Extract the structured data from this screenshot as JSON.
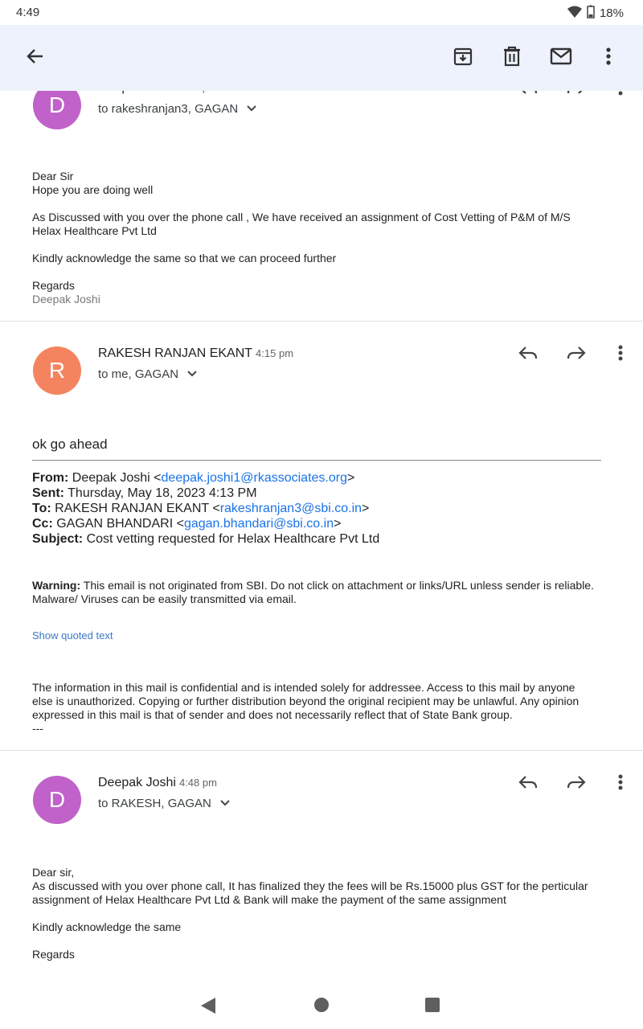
{
  "status": {
    "time": "4:49",
    "battery": "18%"
  },
  "toolbar": {
    "back_icon": "arrow-back-icon",
    "archive_icon": "archive-icon",
    "delete_icon": "trash-icon",
    "mark_unread_icon": "mail-icon",
    "more_icon": "more-vert-icon"
  },
  "messages": [
    {
      "avatar_letter": "D",
      "avatar_color": "#c062c9",
      "sender": "Deepak Joshi",
      "time": "4:13 pm",
      "recipients": "to rakeshranjan3, GAGAN",
      "body": [
        "Dear Sir",
        "Hope you are doing well",
        "As Discussed with you over the phone call , We have received an assignment of Cost Vetting of P&M of M/S",
        "Helax Healthcare Pvt Ltd",
        "Kindly acknowledge the same so that we can proceed further",
        "Regards",
        "Deepak Joshi"
      ]
    },
    {
      "avatar_letter": "R",
      "avatar_color": "#f4845f",
      "sender": "RAKESH RANJAN EKANT",
      "time": "4:15 pm",
      "recipients": "to me, GAGAN",
      "reply": "ok go ahead",
      "quoted": {
        "from_label": "From:",
        "from_name": "Deepak Joshi <",
        "from_email": "deepak.joshi1@rkassociates.org",
        "from_end": ">",
        "sent_label": "Sent:",
        "sent": "Thursday, May 18, 2023 4:13 PM",
        "to_label": "To:",
        "to_name": "RAKESH RANJAN EKANT <",
        "to_email": "rakeshranjan3@sbi.co.in",
        "to_end": ">",
        "cc_label": "Cc:",
        "cc_name": "GAGAN BHANDARI <",
        "cc_email": "gagan.bhandari@sbi.co.in",
        "cc_end": ">",
        "subject_label": "Subject:",
        "subject": "Cost vetting requested for Helax Healthcare Pvt Ltd"
      },
      "warning_label": "Warning:",
      "warning": "This email is not originated from SBI. Do not click on attachment or links/URL unless sender is reliable.",
      "warning2": "Malware/ Viruses can be easily transmitted via email.",
      "show_quoted": "Show quoted text",
      "disclaimer": [
        "The information in this mail is confidential and is intended solely for addressee. Access to this mail by anyone",
        "else is unauthorized. Copying or further distribution beyond the original recipient may be unlawful. Any opinion",
        "expressed in this mail is that of sender and does not necessarily reflect that of State Bank group.",
        "---"
      ]
    },
    {
      "avatar_letter": "D",
      "avatar_color": "#c062c9",
      "sender": "Deepak Joshi",
      "time": "4:48 pm",
      "recipients": "to RAKESH, GAGAN",
      "body": [
        "Dear sir,",
        "As discussed with you over phone call, It has finalized they the fees will be Rs.15000 plus GST for the perticular",
        "assignment of Helax Healthcare Pvt Ltd & Bank will make the payment of the same assignment",
        "Kindly acknowledge the same",
        "Regards"
      ]
    }
  ]
}
